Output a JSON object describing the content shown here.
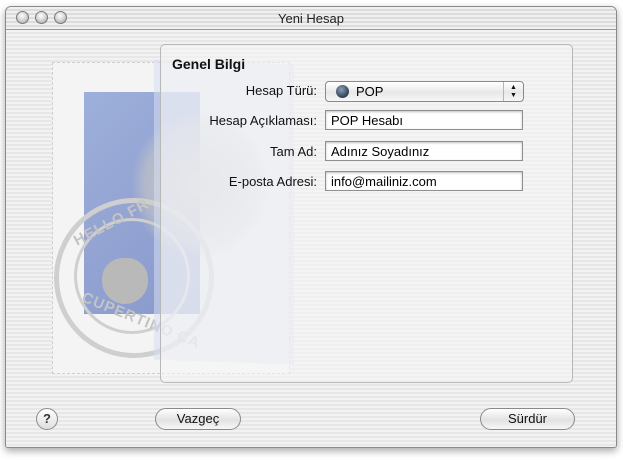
{
  "window": {
    "title": "Yeni Hesap"
  },
  "section": {
    "title": "Genel Bilgi"
  },
  "form": {
    "account_type_label": "Hesap Türü:",
    "account_type_value": "POP",
    "account_type_icon": "globe-icon",
    "description_label": "Hesap Açıklaması:",
    "description_value": "POP Hesabı",
    "full_name_label": "Tam Ad:",
    "full_name_value": "Adınız Soyadınız",
    "email_label": "E-posta Adresi:",
    "email_value": "info@mailiniz.com"
  },
  "illustration": {
    "stamp_text_top": "HELLO FR",
    "stamp_text_bottom": "CUPERTINO CA"
  },
  "buttons": {
    "help": "?",
    "cancel": "Vazgeç",
    "continue": "Sürdür"
  }
}
